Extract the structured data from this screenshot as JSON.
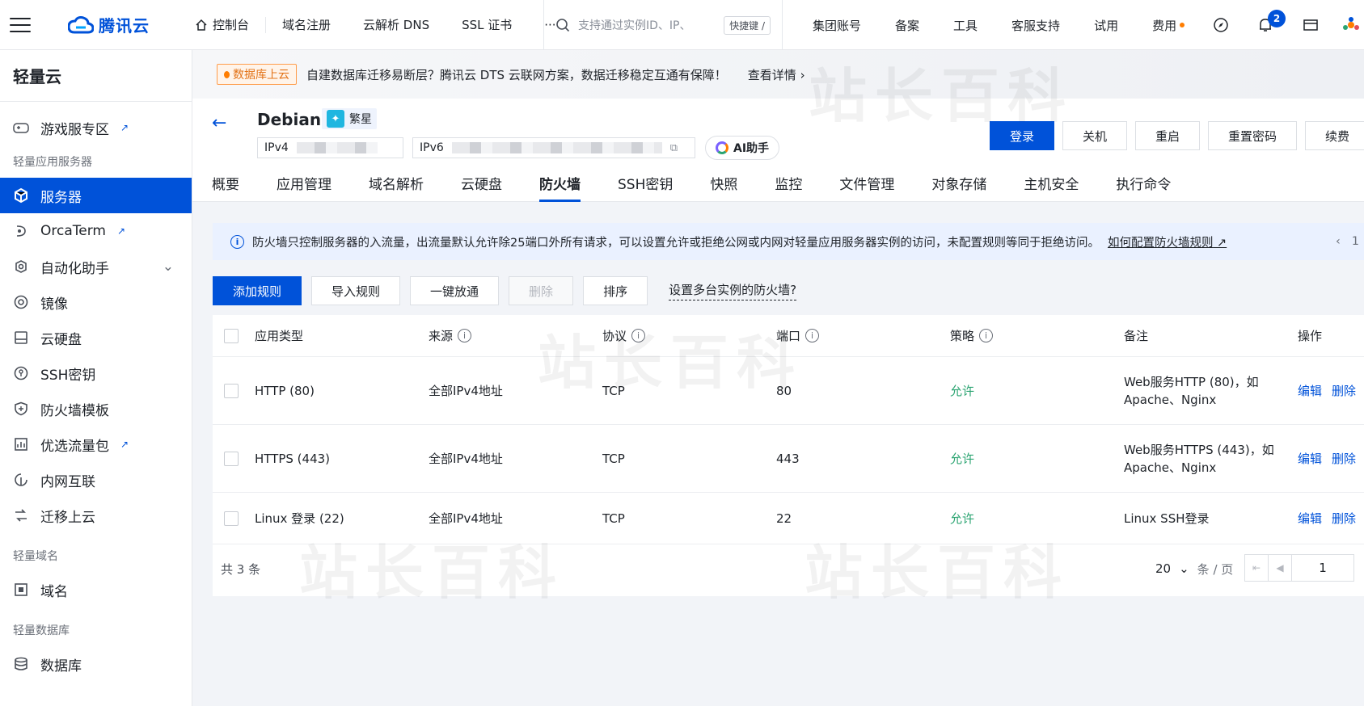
{
  "topbar": {
    "brand": "腾讯云",
    "nav": [
      "控制台",
      "域名注册",
      "云解析 DNS",
      "SSL 证书"
    ],
    "more": "···",
    "search_placeholder": "支持通过实例ID、IP、",
    "search_shortcut": "快捷键 /",
    "right": [
      "集团账号",
      "备案",
      "工具",
      "客服支持",
      "试用",
      "费用"
    ],
    "notification_count": "2"
  },
  "sidebar": {
    "title": "轻量云",
    "items": [
      {
        "label": "游戏服专区",
        "icon": "gamepad-icon",
        "external": true
      },
      {
        "group": "轻量应用服务器"
      },
      {
        "label": "服务器",
        "icon": "server-icon",
        "active": true
      },
      {
        "label": "OrcaTerm",
        "icon": "terminal-icon",
        "external": true
      },
      {
        "label": "自动化助手",
        "icon": "automation-icon",
        "expandable": true
      },
      {
        "label": "镜像",
        "icon": "image-icon"
      },
      {
        "label": "云硬盘",
        "icon": "disk-icon"
      },
      {
        "label": "SSH密钥",
        "icon": "key-icon"
      },
      {
        "label": "防火墙模板",
        "icon": "shield-icon"
      },
      {
        "label": "优选流量包",
        "icon": "traffic-icon",
        "external": true
      },
      {
        "label": "内网互联",
        "icon": "network-icon"
      },
      {
        "label": "迁移上云",
        "icon": "migrate-icon"
      },
      {
        "group": "轻量域名"
      },
      {
        "label": "域名",
        "icon": "domain-icon"
      },
      {
        "group": "轻量数据库"
      },
      {
        "label": "数据库",
        "icon": "database-icon"
      }
    ]
  },
  "banner": {
    "tag": "数据库上云",
    "message": "自建数据库迁移易断层？腾讯云 DTS 云联网方案，数据迁移稳定互通有保障！",
    "link": "查看详情"
  },
  "instance": {
    "name": "Debian",
    "tag": "繁星",
    "ipv4_label": "IPv4",
    "ipv6_label": "IPv6",
    "ai_label": "AI助手",
    "actions": [
      "登录",
      "关机",
      "重启",
      "重置密码",
      "续费"
    ]
  },
  "tabs": [
    "概要",
    "应用管理",
    "域名解析",
    "云硬盘",
    "防火墙",
    "SSH密钥",
    "快照",
    "监控",
    "文件管理",
    "对象存储",
    "主机安全",
    "执行命令"
  ],
  "active_tab": "防火墙",
  "info": {
    "text": "防火墙只控制服务器的入流量，出流量默认允许除25端口外所有请求，可以设置允许或拒绝公网或内网对轻量应用服务器实例的访问，未配置规则等同于拒绝访问。",
    "link": "如何配置防火墙规则",
    "pager": "1"
  },
  "toolbar": {
    "add": "添加规则",
    "import": "导入规则",
    "open_all": "一键放通",
    "delete": "删除",
    "sort": "排序",
    "multi": "设置多台实例的防火墙?"
  },
  "table": {
    "headers": [
      "应用类型",
      "来源",
      "协议",
      "端口",
      "策略",
      "备注",
      "操作"
    ],
    "rows": [
      {
        "app": "HTTP (80)",
        "source": "全部IPv4地址",
        "protocol": "TCP",
        "port": "80",
        "policy": "允许",
        "note1": "Web服务HTTP (80)，如",
        "note2": "Apache、Nginx"
      },
      {
        "app": "HTTPS (443)",
        "source": "全部IPv4地址",
        "protocol": "TCP",
        "port": "443",
        "policy": "允许",
        "note1": "Web服务HTTPS (443)，如",
        "note2": "Apache、Nginx"
      },
      {
        "app": "Linux 登录 (22)",
        "source": "全部IPv4地址",
        "protocol": "TCP",
        "port": "22",
        "policy": "允许",
        "note1": "Linux SSH登录",
        "note2": ""
      }
    ],
    "edit": "编辑",
    "delete": "删除",
    "total": "共 3 条",
    "page_size": "20",
    "page_unit": "条 / 页",
    "page": "1"
  },
  "watermark": "站长百科"
}
